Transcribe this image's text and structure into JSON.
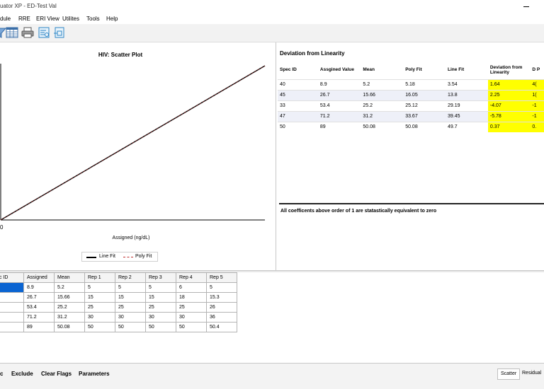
{
  "window": {
    "title": "uator XP - ED-Test Val"
  },
  "menu": {
    "items": [
      "dule",
      "RRE",
      "ERI View",
      "Utilites",
      "Tools",
      "Help"
    ]
  },
  "chart": {
    "title": "HIV: Scatter Plot",
    "x_tick_origin": "0",
    "xlabel": "Assigned (ng/dL)",
    "legend": {
      "line_fit": "Line Fit",
      "poly_fit": "Poly Fit"
    }
  },
  "chart_data": {
    "type": "line",
    "title": "HIV: Scatter Plot",
    "xlabel": "Assigned (ng/dL)",
    "ylabel": "",
    "series": [
      {
        "name": "Line Fit",
        "x": [
          0,
          89
        ],
        "y": [
          0,
          89
        ]
      },
      {
        "name": "Poly Fit",
        "x": [
          0,
          89
        ],
        "y": [
          0,
          89
        ]
      }
    ],
    "legend": "bottom-center",
    "grid": false
  },
  "deviation": {
    "title": "Deviation from Linearity",
    "headers": [
      "Spec ID",
      "Assgined Value",
      "Mean",
      "Poly Fit",
      "Line Fit",
      "Deviation from Linearity",
      "D P"
    ],
    "rows": [
      [
        "40",
        "8.9",
        "5.2",
        "5.18",
        "3.54",
        "1.64",
        "4("
      ],
      [
        "45",
        "26.7",
        "15.66",
        "16.05",
        "13.8",
        "2.25",
        "1("
      ],
      [
        "33",
        "53.4",
        "25.2",
        "25.12",
        "29.19",
        "-4.07",
        "-1"
      ],
      [
        "47",
        "71.2",
        "31.2",
        "33.67",
        "39.45",
        "-5.78",
        "-1"
      ],
      [
        "50",
        "89",
        "50.08",
        "50.08",
        "49.7",
        "0.37",
        "0."
      ]
    ],
    "note": "All coefficents above order of 1 are statastically equivalent to zero",
    "highlight_color": "#ffff00"
  },
  "grid": {
    "headers": [
      "c ID",
      "Assigned",
      "Mean",
      "Rep 1",
      "Rep 2",
      "Rep 3",
      "Rep 4",
      "Rep 5"
    ],
    "rows": [
      [
        "",
        "8.9",
        "5.2",
        "5",
        "5",
        "5",
        "6",
        "5"
      ],
      [
        "",
        "26.7",
        "15.66",
        "15",
        "15",
        "15",
        "18",
        "15.3"
      ],
      [
        "",
        "53.4",
        "25.2",
        "25",
        "25",
        "25",
        "25",
        "26"
      ],
      [
        "",
        "71.2",
        "31.2",
        "30",
        "30",
        "30",
        "30",
        "36"
      ],
      [
        "",
        "89",
        "50.08",
        "50",
        "50",
        "50",
        "50",
        "50.4"
      ]
    ]
  },
  "bottom": {
    "buttons": [
      "c",
      "Exclude",
      "Clear Flags",
      "Parameters"
    ],
    "tabs": [
      "Scatter",
      "Residual"
    ]
  }
}
